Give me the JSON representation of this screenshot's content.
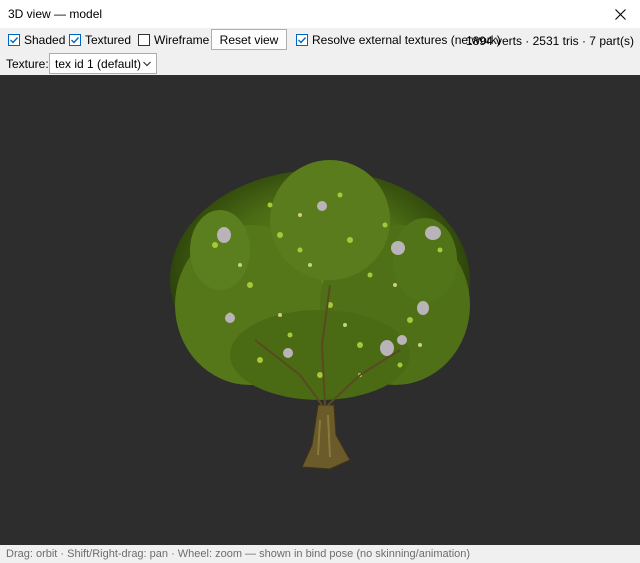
{
  "window": {
    "title": "3D view — model"
  },
  "toolbar": {
    "shaded": {
      "label": "Shaded",
      "checked": true
    },
    "textured": {
      "label": "Textured",
      "checked": true
    },
    "wireframe": {
      "label": "Wireframe",
      "checked": false
    },
    "reset_label": "Reset view",
    "resolve": {
      "label": "Resolve external textures (network)",
      "checked": true
    },
    "stats": "1894 verts · 2531 tris · 7 part(s)"
  },
  "texture": {
    "label": "Texture:",
    "selected": "tex id 1 (default)"
  },
  "viewport": {
    "background": "#2d2d2d",
    "content": "tree-model"
  },
  "status": {
    "text": "Drag: orbit · Shift/Right-drag: pan · Wheel: zoom — shown in bind pose (no skinning/animation)"
  },
  "colors": {
    "accent": "#0067c0"
  },
  "icons": {
    "close": "close-icon",
    "check": "checkmark-icon",
    "chevron": "chevron-down-icon"
  }
}
